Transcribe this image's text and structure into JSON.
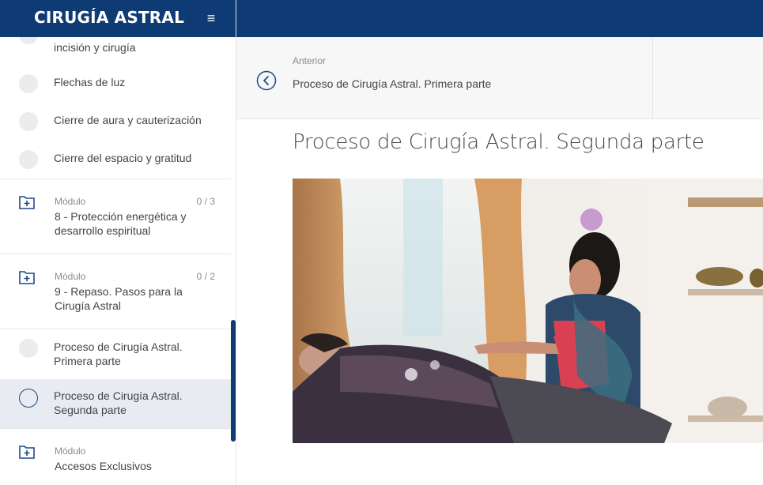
{
  "app": {
    "brand": "CIRUGÍA ASTRAL"
  },
  "sidebar": {
    "lessons_top": [
      {
        "label": "incisión y cirugía"
      },
      {
        "label": "Flechas de luz"
      },
      {
        "label": "Cierre de aura y cauterización"
      },
      {
        "label": "Cierre del espacio y gratitud"
      }
    ],
    "modules": [
      {
        "label": "Módulo",
        "count": "0 / 3",
        "title": "8 - Protección energética y desarrollo espiritual"
      },
      {
        "label": "Módulo",
        "count": "0 / 2",
        "title": "9 - Repaso. Pasos para la Cirugía Astral"
      },
      {
        "label": "Módulo",
        "title": "Accesos Exclusivos"
      }
    ],
    "lessons_bottom": [
      {
        "label": "Proceso de Cirugía Astral. Primera parte"
      },
      {
        "label": "Proceso de Cirugía Astral. Segunda parte"
      }
    ]
  },
  "nav": {
    "prev_label": "Anterior",
    "prev_title": "Proceso de Cirugía Astral. Primera parte"
  },
  "main": {
    "lesson_title": "Proceso de Cirugía Astral. Segunda parte"
  },
  "colors": {
    "brand": "#0f3b75",
    "active_row": "#e8ebf1"
  }
}
